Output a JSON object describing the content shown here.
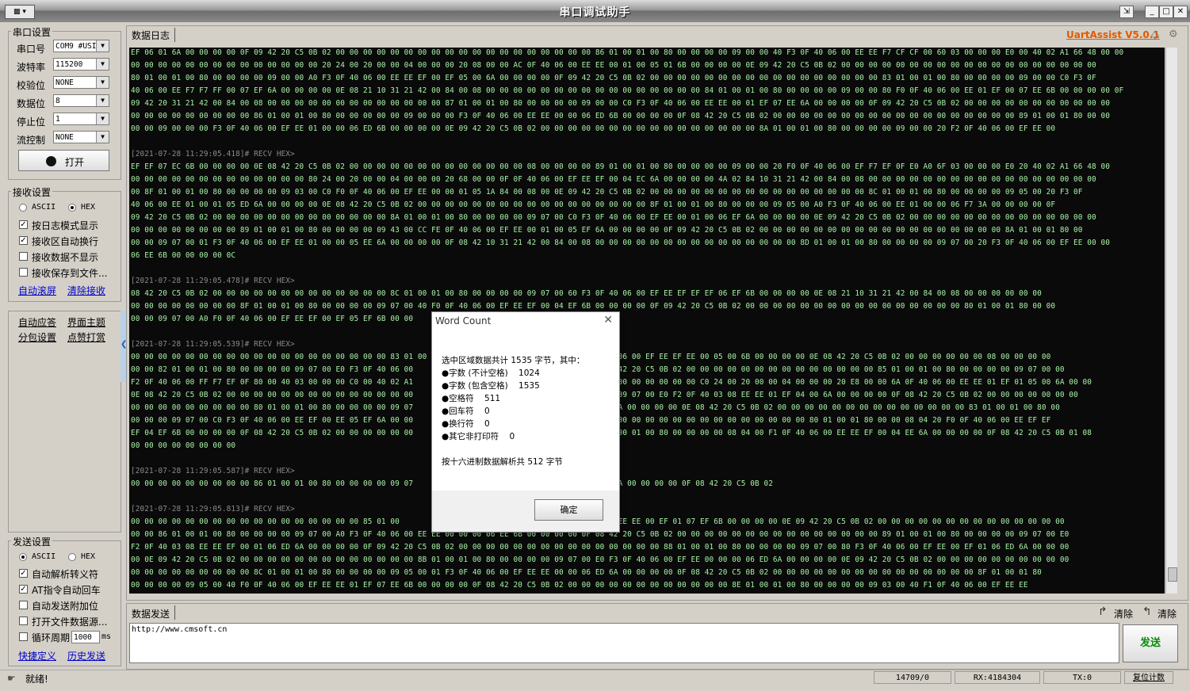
{
  "window": {
    "title": "串口调试助手",
    "sysmenu_label": "▩ ▾",
    "brand": "UartAssist V5.0.1"
  },
  "serial_settings": {
    "title": "串口设置",
    "port_label": "串口号",
    "port_value": "COM9 #USI",
    "baud_label": "波特率",
    "baud_value": "115200",
    "parity_label": "校验位",
    "parity_value": "NONE",
    "databits_label": "数据位",
    "databits_value": "8",
    "stopbits_label": "停止位",
    "stopbits_value": "1",
    "flow_label": "流控制",
    "flow_value": "NONE",
    "open_button": "打开"
  },
  "receive_settings": {
    "title": "接收设置",
    "ascii_label": "ASCII",
    "hex_label": "HEX",
    "selected": "HEX",
    "options": [
      {
        "label": "按日志模式显示",
        "checked": true
      },
      {
        "label": "接收区自动换行",
        "checked": true
      },
      {
        "label": "接收数据不显示",
        "checked": false
      },
      {
        "label": "接收保存到文件...",
        "checked": false
      }
    ],
    "auto_scroll_link": "自动滚屏",
    "clear_link": "清除接收"
  },
  "extra_links": {
    "auto_reply": "自动应答",
    "theme": "界面主题",
    "packet": "分包设置",
    "reward": "点赞打赏"
  },
  "send_settings": {
    "title": "发送设置",
    "ascii_label": "ASCII",
    "hex_label": "HEX",
    "selected": "ASCII",
    "options": [
      {
        "label": "自动解析转义符",
        "checked": true
      },
      {
        "label": "AT指令自动回车",
        "checked": true
      },
      {
        "label": "自动发送附加位",
        "checked": false
      },
      {
        "label": "打开文件数据源...",
        "checked": false
      }
    ],
    "cycle_label": "循环周期",
    "cycle_value": "1000",
    "cycle_unit": "ms",
    "shortcut_link": "快捷定义",
    "history_link": "历史发送"
  },
  "log": {
    "tab": "数据日志",
    "lines": [
      {
        "t": "d",
        "s": "EF 06 01 6A 00 00 00 00 0F 09 42 20 C5 0B 02 00 00 00 00 00 00 00 00 00 00 00 00 00 00 00 00 00 00 00 86 01 00 01 00 80 00 00 00 00 09 00 00 40 F3 0F 40 06 00 EE EE F7 CF CF 00 60 03 00 00 00 E0 00 40 02 A1 66 48 00 00"
      },
      {
        "t": "d",
        "s": "00 00 00 00 00 00 00 00 00 00 00 00 00 00 20 24 00 20 00 00 04 00 00 00 20 08 00 00 AC 0F 40 06 00 EE EE 00 01 00 05 01 6B 00 00 00 00 0E 09 42 20 C5 0B 02 00 00 00 00 00 00 00 00 00 00 00 00 00 00 00 00 00 00 00"
      },
      {
        "t": "d",
        "s": "80 01 00 01 00 80 00 00 00 00 09 00 00 A0 F3 0F 40 06 00 EE EE EF 00 EF 05 00 6A 00 00 00 00 0F 09 42 20 C5 0B 02 00 00 00 00 00 00 00 00 00 00 00 00 00 00 00 00 00 83 01 00 01 00 80 00 00 00 00 09 00 00 C0 F3 0F"
      },
      {
        "t": "d",
        "s": "40 06 00 EE F7 F7 FF 00 07 EF 6A 00 00 00 00 0E 08 21 10 31 21 42 00 84 00 08 00 00 00 00 00 00 00 00 00 00 00 00 00 00 00 00 84 01 00 01 00 80 00 00 00 00 09 00 00 80 F0 0F 40 06 00 EE 01 EF 00 07 EE 6B 00 00 00 00 0F"
      },
      {
        "t": "d",
        "s": "09 42 20 31 21 42 00 84 00 08 00 00 00 00 00 00 00 00 00 00 00 00 00 87 01 00 01 00 80 00 00 00 00 09 00 00 C0 F3 0F 40 06 00 EE EE 00 01 EF 07 EE 6A 00 00 00 00 0F 09 42 20 C5 0B 02 00 00 00 00 00 00 00 00 00 00 00"
      },
      {
        "t": "d",
        "s": "00 00 00 00 00 00 00 00 00 86 01 00 01 00 80 00 00 00 00 00 09 00 00 00 F3 0F 40 06 00 EE EE 00 00 06 ED 6B 00 00 00 00 0F 08 42 20 C5 0B 02 00 00 00 00 00 00 00 00 00 00 00 00 00 00 00 00 00 00 89 01 00 01 80 00 00"
      },
      {
        "t": "d",
        "s": "00 00 09 00 00 00 F3 0F 40 06 00 EF EE 01 00 00 06 ED 6B 00 00 00 00 0E 09 42 20 C5 0B 02 00 00 00 00 00 00 00 00 00 00 00 00 00 00 00 00 8A 01 00 01 00 80 00 00 00 00 09 00 00 20 F2 0F 40 06 00 EF EE 00"
      },
      {
        "t": "b",
        "s": ""
      },
      {
        "t": "h",
        "s": "[2021-07-28 11:29:05.418]# RECV HEX>"
      },
      {
        "t": "d",
        "s": "EF EF 07 EC 6B 00 00 00 00 0E 08 42 20 C5 0B 02 00 00 00 00 00 00 00 00 00 00 00 00 00 08 00 00 00 00 89 01 00 01 00 80 00 00 00 00 09 00 00 20 F0 0F 40 06 00 EF F7 EF 0F E0 A0 6F 03 00 00 00 E0 20 40 02 A1 66 48 00"
      },
      {
        "t": "d",
        "s": "00 00 00 00 00 00 00 00 00 00 00 00 00 80 24 00 20 00 00 04 00 00 00 20 68 00 00 0F 0F 40 06 00 EF EE EF 00 04 EC 6A 00 00 00 00 4A 02 84 10 31 21 42 00 84 00 08 00 00 00 00 00 00 00 00 00 00 00 00 00 00 00 00 00"
      },
      {
        "t": "d",
        "s": "00 8F 01 00 01 00 80 00 00 00 00 09 03 00 C0 F0 0F 40 06 00 EF EE 00 00 01 05 1A 84 00 08 00 0E 09 42 20 C5 0B 02 00 00 00 00 00 00 00 00 00 00 00 00 00 00 00 00 8C 01 00 01 00 80 00 00 00 00 09 05 00 20 F3 0F"
      },
      {
        "t": "d",
        "s": "40 06 00 EE 01 00 01 05 ED 6A 00 00 00 00 0E 08 42 20 C5 0B 02 00 00 00 00 00 00 00 00 00 00 00 00 00 00 00 00 00 8F 01 00 01 00 80 00 00 00 09 05 00 A0 F3 0F 40 06 00 EE 01 00 00 06 F7 3A 00 00 00 00 0F"
      },
      {
        "t": "d",
        "s": "09 42 20 C5 0B 02 00 00 00 00 00 00 00 00 00 00 00 00 00 8A 01 00 01 00 80 00 00 00 00 09 07 00 C0 F3 0F 40 06 00 EF EE 00 01 00 06 EF 6A 00 00 00 00 0E 09 42 20 C5 0B 02 00 00 00 00 00 00 00 00 00 00 00 00 00 00"
      },
      {
        "t": "d",
        "s": "00 00 00 00 00 00 00 00 89 01 00 01 00 80 00 00 00 00 09 43 00 CC FE 0F 40 06 00 EF EE 00 01 00 05 EF 6A 00 00 00 00 0F 09 42 20 C5 0B 02 00 00 00 00 00 00 00 00 00 00 00 00 00 00 00 00 00 00 8A 01 00 01 80 00"
      },
      {
        "t": "d",
        "s": "00 00 09 07 00 01 F3 0F 40 06 00 EF EE 01 00 00 05 EE 6A 00 00 00 00 0F 08 42 10 31 21 42 00 84 00 08 00 00 00 00 00 00 00 00 00 00 00 00 00 00 00 8D 01 00 01 00 80 00 00 00 00 09 07 00 20 F3 0F 40 06 00 EF EE 00 00"
      },
      {
        "t": "d",
        "s": "06 EE 6B 00 00 00 00 0C"
      },
      {
        "t": "b",
        "s": ""
      },
      {
        "t": "h",
        "s": "[2021-07-28 11:29:05.478]# RECV HEX>"
      },
      {
        "t": "d",
        "s": "08 42 20 C5 0B 02 00 00 00 00 00 00 00 00 00 00 00 00 00 8C 01 00 01 00 80 00 00 00 00 09 07 00 60 F3 0F 40 06 00 EF EE EF EF EF 06 EF 6B 00 00 00 00 0E 08 21 10 31 21 42 00 84 00 08 00 00 00 00 00 00"
      },
      {
        "t": "d",
        "s": "00 00 00 00 00 00 00 00 8F 01 00 01 00 80 00 00 00 00 09 07 00 40 F0 0F 40 06 00 EF EE EF 00 04 EF 6B 00 00 00 00 0F 09 42 20 C5 0B 02 00 00 00 00 00 00 00 00 00 00 00 00 00 00 00 00 80 01 00 01 80 00 00"
      },
      {
        "t": "d",
        "s": "00 00 09 07 00 A0 F0 0F 40 06 00 EF EE EF 00 EF 05 EF 6B 00 00"
      },
      {
        "t": "b",
        "s": ""
      },
      {
        "t": "h",
        "s": "[2021-07-28 11:29:05.539]# RECV HEX>"
      },
      {
        "t": "d",
        "s": "00 00 00 00 00 00 00 00 00 00 00 00 00 00 00 00 00 00 00 83 01 00                                       40 06 00 EF EE EF EE 00 05 00 6B 00 00 00 00 0E 08 42 20 C5 0B 02 00 00 00 00 00 00 08 00 00 00 00"
      },
      {
        "t": "d",
        "s": "00 00 82 01 00 01 00 80 00 00 00 00 09 07 00 E0 F3 0F 40 06 00                                          0B 42 20 C5 0B 02 00 00 00 00 00 00 00 00 00 00 00 00 00 00 85 01 00 01 00 80 00 00 00 00 09 07 00 00"
      },
      {
        "t": "d",
        "s": "F2 0F 40 06 00 FF F7 EF 0F 80 00 40 03 00 00 00 C0 00 40 02 A1                                          00 00 00 00 00 00 00 C0 24 00 20 00 00 04 00 00 00 20 E8 00 00 6A 0F 40 06 00 EE EE 01 EF 01 05 00 6A 00 00"
      },
      {
        "t": "d",
        "s": "0E 08 42 20 C5 0B 02 00 00 00 00 00 00 00 00 00 00 00 00 00 00                                          00 09 07 00 E0 F2 0F 40 03 08 EE EE 01 EF 04 00 6A 00 00 00 00 0F 08 42 20 C5 0B 02 00 00 00 00 00 00 00"
      },
      {
        "t": "d",
        "s": "00 00 00 00 00 00 00 00 00 80 01 00 01 00 80 00 00 00 00 09 07                                          F 6A 00 00 00 00 0E 08 42 20 C5 0B 02 00 00 00 00 00 00 00 00 00 00 00 00 00 00 83 01 00 01 00 80 00"
      },
      {
        "t": "d",
        "s": "00 00 00 09 07 00 C0 F3 0F 40 06 00 EE EF 00 EE 05 EF 6A 00 00                                          00 00 00 00 00 00 00 00 00 00 00 00 00 00 00 80 01 00 01 80 00 00 08 04 20 F0 0F 40 06 00 EE EF EF"
      },
      {
        "t": "d",
        "s": "EF 04 EF 6B 00 00 00 00 0F 08 42 20 C5 0B 02 00 00 00 00 00 00                                          01 00 01 00 80 00 00 00 00 08 04 00 F1 0F 40 06 00 EE EE EF 00 04 EE 6A 00 00 00 00 0F 08 42 20 C5 0B 01 08"
      },
      {
        "t": "d",
        "s": "00 00 00 00 00 00 00 00"
      },
      {
        "t": "b",
        "s": ""
      },
      {
        "t": "h",
        "s": "[2021-07-28 11:29:05.587]# RECV HEX>"
      },
      {
        "t": "d",
        "s": "00 00 00 00 00 00 00 00 00 86 01 00 01 00 80 00 00 00 00 09 07                                          E 6A 00 00 00 00 0F 08 42 20 C5 0B 02"
      },
      {
        "t": "b",
        "s": ""
      },
      {
        "t": "h",
        "s": "[2021-07-28 11:29:05.813]# RECV HEX>"
      },
      {
        "t": "d",
        "s": "00 00 00 00 00 00 00 00 00 00 00 00 00 00 00 00 00 85 01 00                                          06 00 EE EE 00 EF 01 07 EF 6B 00 00 00 00 0E 09 42 20 C5 0B 02 00 00 00 00 00 00 00 00 00 00 00 00 00 00"
      },
      {
        "t": "d",
        "s": "00 00 86 01 00 01 00 80 00 00 00 00 09 07 00 A0 F3 0F 40 06 00 EE EE 00 00 00 06 EE 6B 00 00 00 00 0F 08 42 20 C5 0B 02 00 00 00 00 00 00 00 00 00 00 00 00 00 00 00 89 01 00 01 00 80 00 00 00 00 09 07 00 E0"
      },
      {
        "t": "d",
        "s": "F2 0F 40 03 08 EE EE EF 00 01 06 ED 6A 00 00 00 00 0F 09 42 20 C5 0B 02 00 00 00 00 00 00 00 00 00 00 00 00 00 00 00 88 01 00 01 00 80 00 00 00 00 09 07 00 80 F3 0F 40 06 00 EF EE 00 EF 01 06 ED 6A 00 00 00"
      },
      {
        "t": "d",
        "s": "00 0E 09 42 20 C5 0B 02 00 00 00 00 00 00 00 00 00 00 00 00 00 8B 01 00 01 00 80 00 00 00 00 09 07 00 E0 F3 0F 40 06 00 EF EE 00 00 00 06 ED 6A 00 00 00 00 0E 09 42 20 C5 0B 02 00 00 00 00 00 00 00 00 00 00"
      },
      {
        "t": "d",
        "s": "00 00 00 00 00 00 00 00 00 8C 01 00 01 00 80 00 00 00 00 09 05 00 01 F3 0F 40 06 00 EF EE EE 00 00 06 ED 6A 00 00 00 00 0F 08 42 20 C5 0B 02 00 00 00 00 00 00 00 00 00 00 00 00 00 00 00 8F 01 00 01 80"
      },
      {
        "t": "d",
        "s": "00 00 00 00 09 05 00 40 F0 0F 40 06 00 EF EE EE 01 EF 07 EE 6B 00 00 00 00 0F 08 42 20 C5 0B 02 00 00 00 00 00 00 00 00 00 00 00 00 8E 01 00 01 00 80 00 00 00 00 09 03 00 40 F1 0F 40 06 00 EF EE EE"
      }
    ]
  },
  "dialog": {
    "title": "Word Count",
    "summary": "选中区域数据共计 1535 字节，其中：",
    "rows": [
      "●字数 (不计空格)    1024",
      "●字数 (包含空格)    1535",
      "●空格符    511",
      "●回车符    0",
      "●换行符    0",
      "●其它非打印符    0"
    ],
    "hex_note": "按十六进制数据解析共 512 字节",
    "ok_button": "确定"
  },
  "send": {
    "tab": "数据发送",
    "clear1": "清除",
    "clear2": "清除",
    "input_value": "http://www.cmsoft.cn",
    "send_button": "发送"
  },
  "status": {
    "ready": "就绪!",
    "counter1": "14709/0",
    "rx": "RX:4184304",
    "tx": "TX:0",
    "reset_button": "复位计数"
  }
}
